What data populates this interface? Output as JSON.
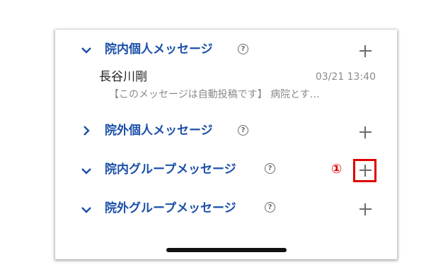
{
  "sections": [
    {
      "chevron": "⌄",
      "title": "院内個人メッセージ",
      "help": "?",
      "expanded": true
    },
    {
      "chevron": "›",
      "title": "院外個人メッセージ",
      "help": "?",
      "expanded": false
    },
    {
      "chevron": "⌄",
      "title": "院内グループメッセージ",
      "help": "?",
      "expanded": true
    },
    {
      "chevron": "⌄",
      "title": "院外グループメッセージ",
      "help": "?",
      "expanded": true
    }
  ],
  "message": {
    "sender": "長谷川剛",
    "time": "03/21 13:40",
    "preview": "【このメッセージは自動投稿です】 病院とす…"
  },
  "annotation": {
    "label": "①",
    "color": "#e00000"
  },
  "colors": {
    "accent": "#1a4fa8",
    "icon": "#6b6b6b"
  }
}
